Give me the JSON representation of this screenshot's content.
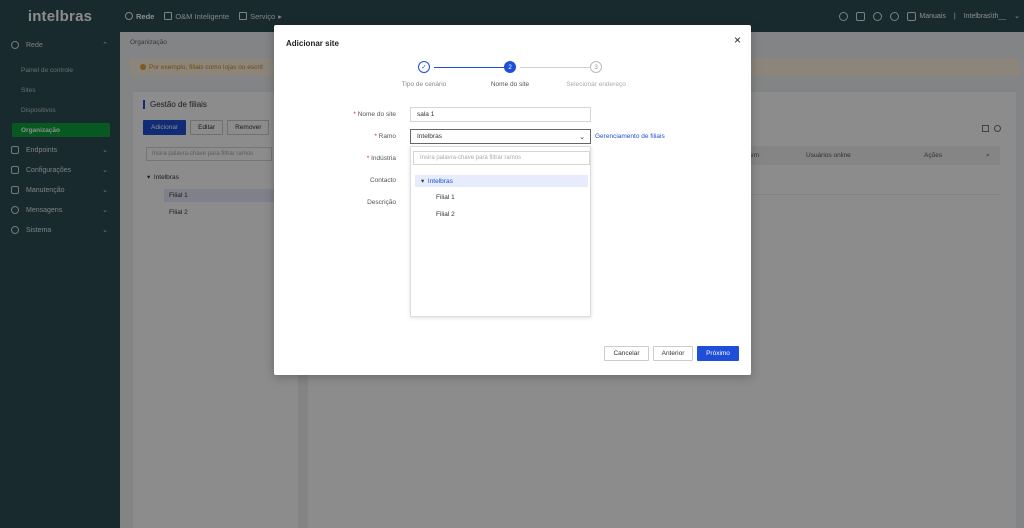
{
  "brand": {
    "logo": "intelbras"
  },
  "topnav": [
    {
      "label": "Rede",
      "icon": "globe-icon",
      "active": true
    },
    {
      "label": "O&M Inteligente",
      "icon": "om-icon",
      "active": false
    },
    {
      "label": "Serviço",
      "icon": "service-icon",
      "active": false
    }
  ],
  "topright": {
    "manuals": "Manuais",
    "user": "Intelbras\\th__"
  },
  "sidebar": {
    "groups": [
      {
        "label": "Rede",
        "icon": "globe-icon",
        "expanded": true,
        "items": [
          "Painel de controle",
          "Sites",
          "Dispositivos",
          "Organização"
        ],
        "active_item": "Organização"
      },
      {
        "label": "Endpoints",
        "icon": "endpoint-icon"
      },
      {
        "label": "Configurações",
        "icon": "settings-icon"
      },
      {
        "label": "Manutenção",
        "icon": "maintenance-icon"
      },
      {
        "label": "Mensagens",
        "icon": "bell-icon"
      },
      {
        "label": "Sistema",
        "icon": "gear-icon"
      }
    ]
  },
  "main": {
    "breadcrumb": "Organização",
    "notice": "Por exemplo, filiais como lojas ou escrit",
    "left_panel": {
      "title": "Gestão de filiais",
      "buttons": {
        "add": "Adicionar",
        "edit": "Editar",
        "remove": "Remover"
      },
      "search_placeholder": "Insira palavra-chave para filtrar ramos",
      "tree": {
        "root": "Intelbras",
        "children": [
          "Filial 1",
          "Filial 2"
        ],
        "selected": "Filial 1"
      }
    },
    "table": {
      "columns": [
        "em",
        "Usuários online",
        "Ações"
      ]
    }
  },
  "modal": {
    "title": "Adicionar site",
    "steps": [
      {
        "number": "1",
        "label": "Tipo de cenário",
        "state": "done"
      },
      {
        "number": "2",
        "label": "Nome do site",
        "state": "active"
      },
      {
        "number": "3",
        "label": "Selecionar endereço",
        "state": "todo"
      }
    ],
    "fields": {
      "site_name": {
        "label": "Nome do site",
        "value": "sala 1",
        "required": true
      },
      "branch": {
        "label": "Ramo",
        "value": "Intelbras",
        "required": true,
        "link": "Gerenciamento de filiais"
      },
      "industry": {
        "label": "Indústria",
        "required": true
      },
      "contact": {
        "label": "Contacto"
      },
      "description": {
        "label": "Descrição"
      }
    },
    "dropdown": {
      "search_placeholder": "Insira palavra-chave para filtrar ramos",
      "root": "Intelbras",
      "children": [
        "Filial 1",
        "Filial 2"
      ]
    },
    "buttons": {
      "cancel": "Cancelar",
      "back": "Anterior",
      "next": "Próximo"
    }
  },
  "colors": {
    "primary": "#1f4fd8",
    "sidebar_bg": "#2f4e55",
    "active_green": "#0fa33c",
    "notice_text": "#d08a1a"
  }
}
